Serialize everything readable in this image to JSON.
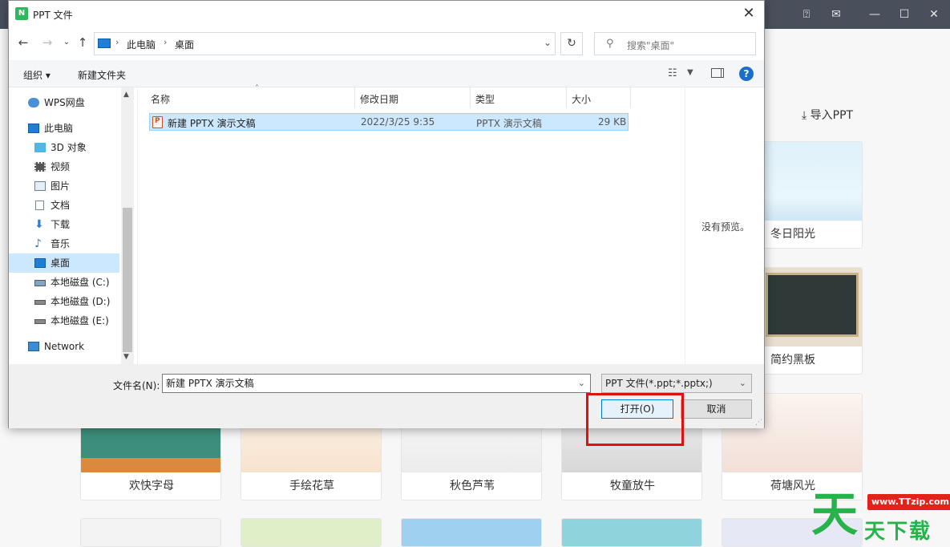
{
  "dialog": {
    "title": "PPT 文件",
    "logo": "N",
    "close": "✕"
  },
  "address": {
    "crumbs": [
      "此电脑",
      "桌面"
    ],
    "search_placeholder": "搜索\"桌面\""
  },
  "toolbar": {
    "organize": "组织 ▾",
    "new_folder": "新建文件夹"
  },
  "nav": {
    "items": [
      {
        "label": "WPS网盘",
        "icon": "cloud-icon"
      },
      {
        "label": "此电脑",
        "icon": "computer-icon"
      },
      {
        "label": "3D 对象",
        "icon": "cube-icon"
      },
      {
        "label": "视频",
        "icon": "film-icon"
      },
      {
        "label": "图片",
        "icon": "picture-icon"
      },
      {
        "label": "文档",
        "icon": "document-icon"
      },
      {
        "label": "下载",
        "icon": "download-icon"
      },
      {
        "label": "音乐",
        "icon": "music-icon"
      },
      {
        "label": "桌面",
        "icon": "desktop-icon",
        "selected": true
      },
      {
        "label": "本地磁盘 (C:)",
        "icon": "drive-icon"
      },
      {
        "label": "本地磁盘 (D:)",
        "icon": "drive-icon"
      },
      {
        "label": "本地磁盘 (E:)",
        "icon": "drive-icon"
      },
      {
        "label": "Network",
        "icon": "network-icon"
      }
    ]
  },
  "files": {
    "columns": [
      "名称",
      "修改日期",
      "类型",
      "大小"
    ],
    "rows": [
      {
        "name": "新建 PPTX 演示文稿",
        "date": "2022/3/25 9:35",
        "type": "PPTX 演示文稿",
        "size": "29 KB"
      }
    ]
  },
  "preview": {
    "empty_text": "没有预览。"
  },
  "footer": {
    "filename_label": "文件名(N):",
    "filename_value": "新建 PPTX 演示文稿",
    "filetype_value": "PPT 文件(*.ppt;*.pptx;)",
    "open_label": "打开(O)",
    "cancel_label": "取消"
  },
  "background": {
    "import_label": "导入PPT",
    "templates": [
      "冬日阳光",
      "简约黑板",
      "欢快字母",
      "手绘花草",
      "秋色芦苇",
      "牧童放牛",
      "荷塘风光"
    ]
  },
  "watermark": {
    "big_char": "天",
    "url": "www.TTzip.com",
    "text": "天下载"
  },
  "colors": {
    "accent": "#0078d7",
    "selection": "#cce8ff",
    "highlight_box": "#e01010",
    "watermark_green": "#26b34a"
  }
}
